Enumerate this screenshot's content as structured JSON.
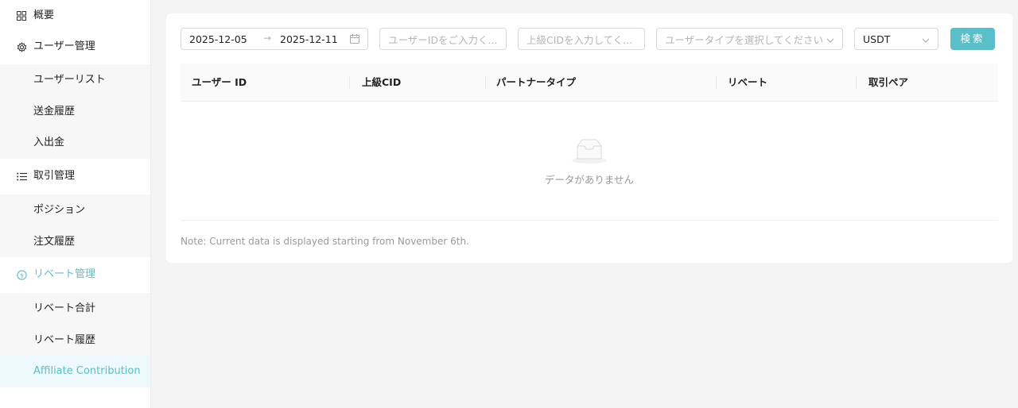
{
  "sidebar": {
    "overview": "概要",
    "user_mgmt": "ユーザー管理",
    "user_items": [
      "ユーザーリスト",
      "送金履歴",
      "入出金"
    ],
    "trade_mgmt": "取引管理",
    "trade_items": [
      "ポジション",
      "注文履歴"
    ],
    "rebate_mgmt": "リベート管理",
    "rebate_items": [
      "リベート合計",
      "リベート履歴",
      "Affiliate Contribution"
    ]
  },
  "filters": {
    "date_start": "2025-12-05",
    "date_end": "2025-12-11",
    "user_id_placeholder": "ユーザーIDをご入力く...",
    "upper_cid_placeholder": "上級CIDを入力してく...",
    "user_type_placeholder": "ユーザータイプを選択してください",
    "currency": "USDT",
    "search_label": "検索"
  },
  "table": {
    "columns": [
      "ユーザー ID",
      "上級CID",
      "パートナータイプ",
      "リベート",
      "取引ペア"
    ],
    "empty_text": "データがありません"
  },
  "note": "Note: Current data is displayed starting from November 6th.",
  "colors": {
    "accent": "#5bbfc9"
  }
}
